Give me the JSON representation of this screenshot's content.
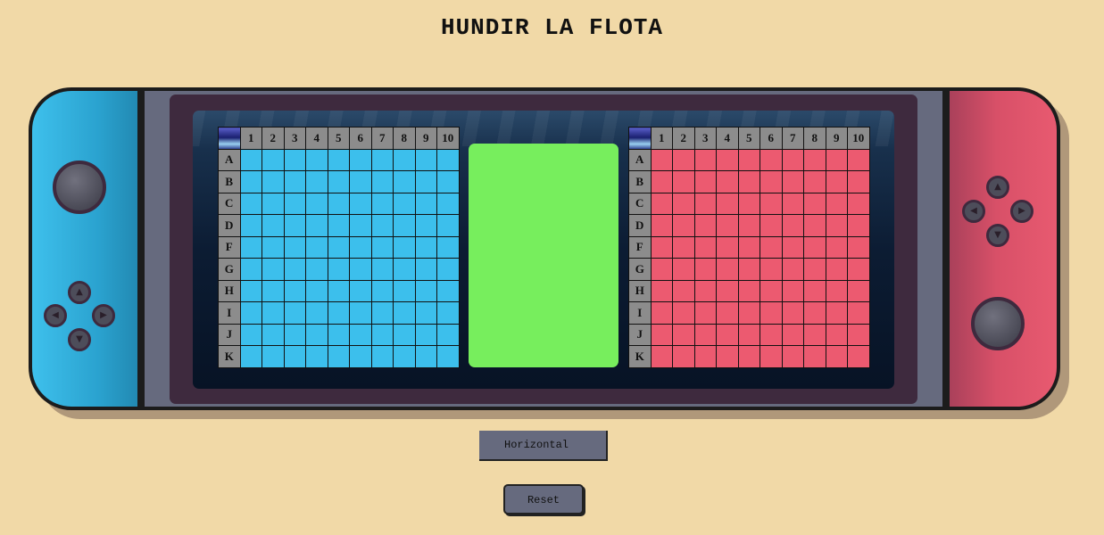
{
  "title": "HUNDIR LA FLOTA",
  "board": {
    "columns": [
      "1",
      "2",
      "3",
      "4",
      "5",
      "6",
      "7",
      "8",
      "9",
      "10"
    ],
    "rows": [
      "A",
      "B",
      "C",
      "D",
      "F",
      "G",
      "H",
      "I",
      "J",
      "K"
    ]
  },
  "controls": {
    "orientation_label": "Horizontal",
    "reset_label": "Reset"
  },
  "colors": {
    "player_board": "#3cbfec",
    "enemy_board": "#ec5a70",
    "info_panel": "#77ee5d",
    "background": "#f1d9a7"
  }
}
